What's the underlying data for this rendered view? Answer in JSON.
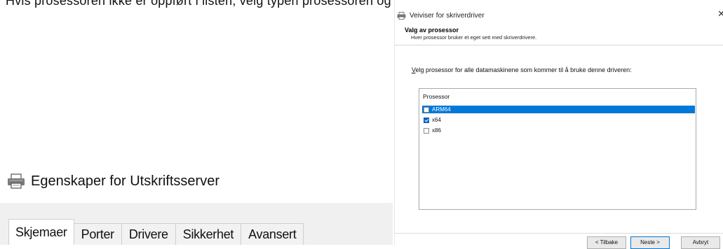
{
  "top_banner_text": "Hvis prosessoren ikke er oppført i listen, velg typen prosessoren og hvilken prosessor",
  "left_dialog": {
    "title": "Egenskaper for Utskriftsserver",
    "tabs": [
      {
        "label": "Skjemaer",
        "active": true
      },
      {
        "label": "Porter",
        "active": false
      },
      {
        "label": "Drivere",
        "active": false
      },
      {
        "label": "Sikkerhet",
        "active": false
      },
      {
        "label": "Avansert",
        "active": false
      }
    ]
  },
  "wizard": {
    "title": "Veiviser for skriverdriver",
    "close_glyph": "✕",
    "header_title": "Valg av prosessor",
    "header_subtitle": "Hver prosessor bruker et eget sett med skriverdrivere.",
    "instruction_accesskey": "V",
    "instruction_rest": "elg prosessor for alle datamaskinene som kommer til å bruke denne driveren:",
    "list_header": "Prosessor",
    "processors": [
      {
        "label": "ARM64",
        "checked": false,
        "selected": true
      },
      {
        "label": "x64",
        "checked": true,
        "selected": false
      },
      {
        "label": "x86",
        "checked": false,
        "selected": false
      }
    ],
    "buttons": {
      "back": "< Tilbake",
      "next": "Neste >",
      "cancel": "Avbryt"
    }
  },
  "colors": {
    "selection": "#0078d7",
    "tab_bar": "#f0f0f0"
  },
  "icons": [
    "printer-icon",
    "close-icon",
    "checkbox-checked-icon"
  ]
}
